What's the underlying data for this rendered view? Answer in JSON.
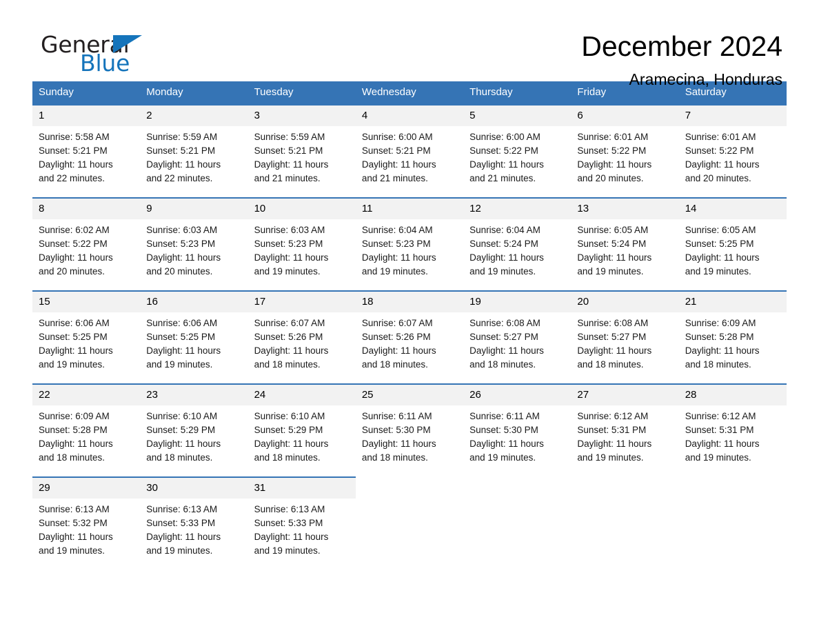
{
  "brand": {
    "name_part1": "General",
    "name_part2": "Blue",
    "triangle_color": "#1574bb"
  },
  "header": {
    "month_title": "December 2024",
    "location": "Aramecina, Honduras"
  },
  "colors": {
    "header_blue": "#3574b5",
    "daynum_gray": "#f2f2f2",
    "brand_blue": "#1574bb"
  },
  "weekdays": [
    "Sunday",
    "Monday",
    "Tuesday",
    "Wednesday",
    "Thursday",
    "Friday",
    "Saturday"
  ],
  "labels": {
    "sunrise_prefix": "Sunrise:",
    "sunset_prefix": "Sunset:",
    "daylight_prefix": "Daylight:"
  },
  "weeks": [
    [
      {
        "day": "1",
        "sunrise": "Sunrise: 5:58 AM",
        "sunset": "Sunset: 5:21 PM",
        "daylight_line1": "Daylight: 11 hours",
        "daylight_line2": "and 22 minutes."
      },
      {
        "day": "2",
        "sunrise": "Sunrise: 5:59 AM",
        "sunset": "Sunset: 5:21 PM",
        "daylight_line1": "Daylight: 11 hours",
        "daylight_line2": "and 22 minutes."
      },
      {
        "day": "3",
        "sunrise": "Sunrise: 5:59 AM",
        "sunset": "Sunset: 5:21 PM",
        "daylight_line1": "Daylight: 11 hours",
        "daylight_line2": "and 21 minutes."
      },
      {
        "day": "4",
        "sunrise": "Sunrise: 6:00 AM",
        "sunset": "Sunset: 5:21 PM",
        "daylight_line1": "Daylight: 11 hours",
        "daylight_line2": "and 21 minutes."
      },
      {
        "day": "5",
        "sunrise": "Sunrise: 6:00 AM",
        "sunset": "Sunset: 5:22 PM",
        "daylight_line1": "Daylight: 11 hours",
        "daylight_line2": "and 21 minutes."
      },
      {
        "day": "6",
        "sunrise": "Sunrise: 6:01 AM",
        "sunset": "Sunset: 5:22 PM",
        "daylight_line1": "Daylight: 11 hours",
        "daylight_line2": "and 20 minutes."
      },
      {
        "day": "7",
        "sunrise": "Sunrise: 6:01 AM",
        "sunset": "Sunset: 5:22 PM",
        "daylight_line1": "Daylight: 11 hours",
        "daylight_line2": "and 20 minutes."
      }
    ],
    [
      {
        "day": "8",
        "sunrise": "Sunrise: 6:02 AM",
        "sunset": "Sunset: 5:22 PM",
        "daylight_line1": "Daylight: 11 hours",
        "daylight_line2": "and 20 minutes."
      },
      {
        "day": "9",
        "sunrise": "Sunrise: 6:03 AM",
        "sunset": "Sunset: 5:23 PM",
        "daylight_line1": "Daylight: 11 hours",
        "daylight_line2": "and 20 minutes."
      },
      {
        "day": "10",
        "sunrise": "Sunrise: 6:03 AM",
        "sunset": "Sunset: 5:23 PM",
        "daylight_line1": "Daylight: 11 hours",
        "daylight_line2": "and 19 minutes."
      },
      {
        "day": "11",
        "sunrise": "Sunrise: 6:04 AM",
        "sunset": "Sunset: 5:23 PM",
        "daylight_line1": "Daylight: 11 hours",
        "daylight_line2": "and 19 minutes."
      },
      {
        "day": "12",
        "sunrise": "Sunrise: 6:04 AM",
        "sunset": "Sunset: 5:24 PM",
        "daylight_line1": "Daylight: 11 hours",
        "daylight_line2": "and 19 minutes."
      },
      {
        "day": "13",
        "sunrise": "Sunrise: 6:05 AM",
        "sunset": "Sunset: 5:24 PM",
        "daylight_line1": "Daylight: 11 hours",
        "daylight_line2": "and 19 minutes."
      },
      {
        "day": "14",
        "sunrise": "Sunrise: 6:05 AM",
        "sunset": "Sunset: 5:25 PM",
        "daylight_line1": "Daylight: 11 hours",
        "daylight_line2": "and 19 minutes."
      }
    ],
    [
      {
        "day": "15",
        "sunrise": "Sunrise: 6:06 AM",
        "sunset": "Sunset: 5:25 PM",
        "daylight_line1": "Daylight: 11 hours",
        "daylight_line2": "and 19 minutes."
      },
      {
        "day": "16",
        "sunrise": "Sunrise: 6:06 AM",
        "sunset": "Sunset: 5:25 PM",
        "daylight_line1": "Daylight: 11 hours",
        "daylight_line2": "and 19 minutes."
      },
      {
        "day": "17",
        "sunrise": "Sunrise: 6:07 AM",
        "sunset": "Sunset: 5:26 PM",
        "daylight_line1": "Daylight: 11 hours",
        "daylight_line2": "and 18 minutes."
      },
      {
        "day": "18",
        "sunrise": "Sunrise: 6:07 AM",
        "sunset": "Sunset: 5:26 PM",
        "daylight_line1": "Daylight: 11 hours",
        "daylight_line2": "and 18 minutes."
      },
      {
        "day": "19",
        "sunrise": "Sunrise: 6:08 AM",
        "sunset": "Sunset: 5:27 PM",
        "daylight_line1": "Daylight: 11 hours",
        "daylight_line2": "and 18 minutes."
      },
      {
        "day": "20",
        "sunrise": "Sunrise: 6:08 AM",
        "sunset": "Sunset: 5:27 PM",
        "daylight_line1": "Daylight: 11 hours",
        "daylight_line2": "and 18 minutes."
      },
      {
        "day": "21",
        "sunrise": "Sunrise: 6:09 AM",
        "sunset": "Sunset: 5:28 PM",
        "daylight_line1": "Daylight: 11 hours",
        "daylight_line2": "and 18 minutes."
      }
    ],
    [
      {
        "day": "22",
        "sunrise": "Sunrise: 6:09 AM",
        "sunset": "Sunset: 5:28 PM",
        "daylight_line1": "Daylight: 11 hours",
        "daylight_line2": "and 18 minutes."
      },
      {
        "day": "23",
        "sunrise": "Sunrise: 6:10 AM",
        "sunset": "Sunset: 5:29 PM",
        "daylight_line1": "Daylight: 11 hours",
        "daylight_line2": "and 18 minutes."
      },
      {
        "day": "24",
        "sunrise": "Sunrise: 6:10 AM",
        "sunset": "Sunset: 5:29 PM",
        "daylight_line1": "Daylight: 11 hours",
        "daylight_line2": "and 18 minutes."
      },
      {
        "day": "25",
        "sunrise": "Sunrise: 6:11 AM",
        "sunset": "Sunset: 5:30 PM",
        "daylight_line1": "Daylight: 11 hours",
        "daylight_line2": "and 18 minutes."
      },
      {
        "day": "26",
        "sunrise": "Sunrise: 6:11 AM",
        "sunset": "Sunset: 5:30 PM",
        "daylight_line1": "Daylight: 11 hours",
        "daylight_line2": "and 19 minutes."
      },
      {
        "day": "27",
        "sunrise": "Sunrise: 6:12 AM",
        "sunset": "Sunset: 5:31 PM",
        "daylight_line1": "Daylight: 11 hours",
        "daylight_line2": "and 19 minutes."
      },
      {
        "day": "28",
        "sunrise": "Sunrise: 6:12 AM",
        "sunset": "Sunset: 5:31 PM",
        "daylight_line1": "Daylight: 11 hours",
        "daylight_line2": "and 19 minutes."
      }
    ],
    [
      {
        "day": "29",
        "sunrise": "Sunrise: 6:13 AM",
        "sunset": "Sunset: 5:32 PM",
        "daylight_line1": "Daylight: 11 hours",
        "daylight_line2": "and 19 minutes."
      },
      {
        "day": "30",
        "sunrise": "Sunrise: 6:13 AM",
        "sunset": "Sunset: 5:33 PM",
        "daylight_line1": "Daylight: 11 hours",
        "daylight_line2": "and 19 minutes."
      },
      {
        "day": "31",
        "sunrise": "Sunrise: 6:13 AM",
        "sunset": "Sunset: 5:33 PM",
        "daylight_line1": "Daylight: 11 hours",
        "daylight_line2": "and 19 minutes."
      },
      {
        "day": "",
        "sunrise": "",
        "sunset": "",
        "daylight_line1": "",
        "daylight_line2": ""
      },
      {
        "day": "",
        "sunrise": "",
        "sunset": "",
        "daylight_line1": "",
        "daylight_line2": ""
      },
      {
        "day": "",
        "sunrise": "",
        "sunset": "",
        "daylight_line1": "",
        "daylight_line2": ""
      },
      {
        "day": "",
        "sunrise": "",
        "sunset": "",
        "daylight_line1": "",
        "daylight_line2": ""
      }
    ]
  ]
}
